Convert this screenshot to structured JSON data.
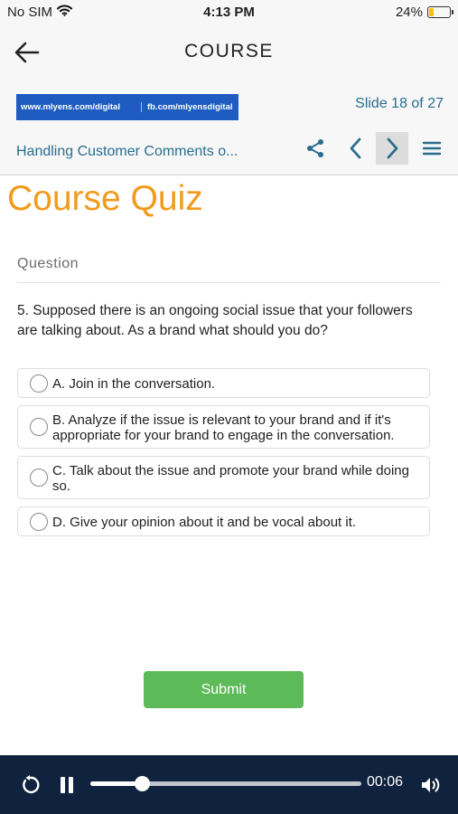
{
  "status": {
    "carrier": "No SIM",
    "time": "4:13 PM",
    "battery_text": "24%",
    "battery_level": 0.24,
    "icons": {
      "wifi": "wifi-icon",
      "battery": "battery-icon"
    }
  },
  "header": {
    "title": "COURSE",
    "back_icon": "arrow-left-icon"
  },
  "course": {
    "banner_left": "www.mlyens.com/digital",
    "banner_right": "fb.com/mlyensdigital",
    "slide_counter": "Slide 18 of 27",
    "lesson_title": "Handling Customer Comments o...",
    "toolbar_icons": [
      "share-icon",
      "chevron-left-icon",
      "chevron-right-icon",
      "menu-icon"
    ]
  },
  "quiz": {
    "title": "Course Quiz",
    "question_label": "Question",
    "question": "5. Supposed there is an ongoing social issue that your followers are talking about. As a brand what should you do?",
    "options": [
      {
        "label": "A. Join in the conversation."
      },
      {
        "label": "B. Analyze if the issue is relevant to your brand and if it's appropriate for your brand to engage in the conversation."
      },
      {
        "label": "C. Talk about the issue and promote your brand while doing so."
      },
      {
        "label": "D. Give your opinion about it and be vocal about it."
      }
    ],
    "submit_label": "Submit"
  },
  "player": {
    "elapsed": "00:06",
    "progress": 0.19,
    "icons": [
      "replay-icon",
      "pause-icon",
      "volume-icon"
    ]
  },
  "colors": {
    "accent_orange": "#f29a1c",
    "link_teal": "#2a6d8c",
    "submit_green": "#5cba58",
    "player_bg": "#0f233f",
    "banner_blue": "#1e5cc2"
  }
}
